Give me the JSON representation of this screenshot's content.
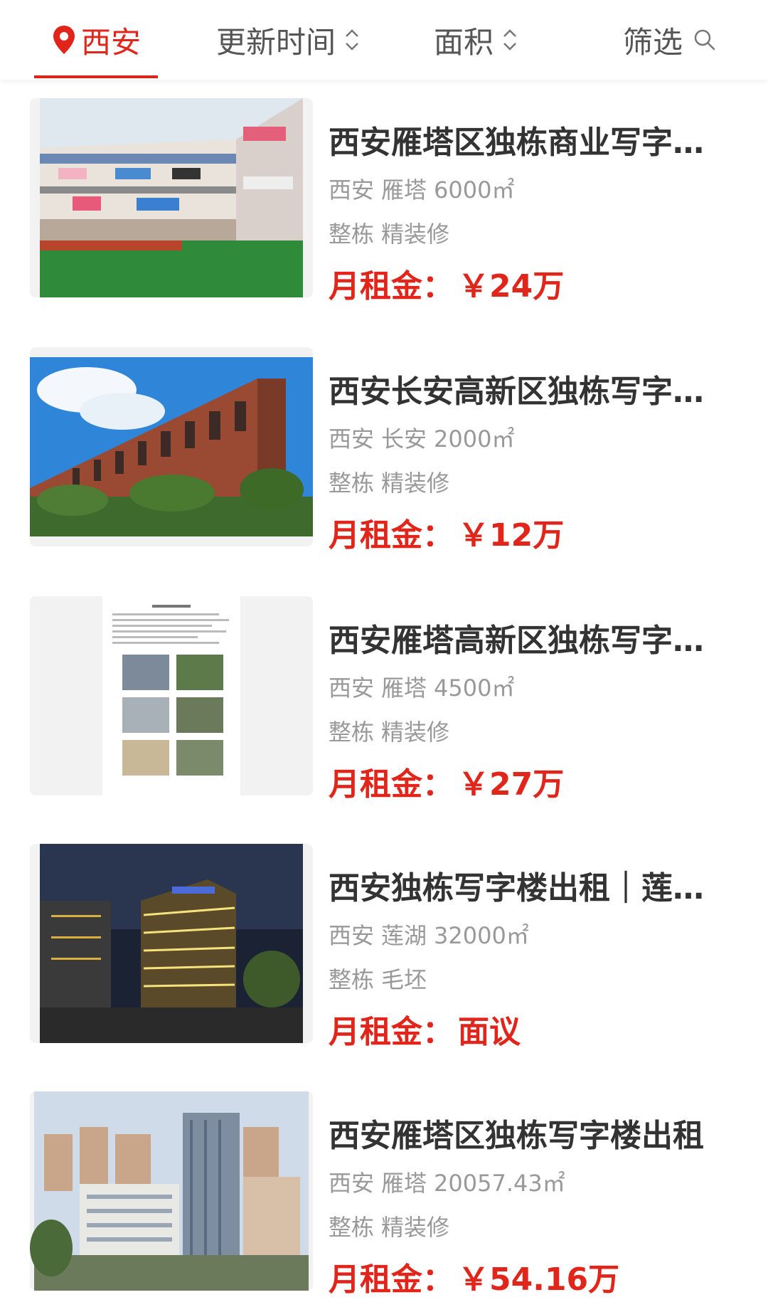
{
  "filter_bar": {
    "city": "西安",
    "sort_time": "更新时间",
    "sort_area": "面积",
    "filter": "筛选"
  },
  "listings": [
    {
      "title": "西安雁塔区独栋商业写字楼出租",
      "city": "西安",
      "district": "雁塔",
      "area": "6000㎡",
      "type": "整栋",
      "decor": "精装修",
      "rent_label": "月租金：",
      "rent": "￥24万"
    },
    {
      "title": "西安长安高新区独栋写字楼出租",
      "city": "西安",
      "district": "长安",
      "area": "2000㎡",
      "type": "整栋",
      "decor": "精装修",
      "rent_label": "月租金：",
      "rent": "￥12万"
    },
    {
      "title": "西安雁塔高新区独栋写字楼出租",
      "city": "西安",
      "district": "雁塔",
      "area": "4500㎡",
      "type": "整栋",
      "decor": "精装修",
      "rent_label": "月租金：",
      "rent": "￥27万"
    },
    {
      "title": "西安独栋写字楼出租｜莲湖区",
      "city": "西安",
      "district": "莲湖",
      "area": "32000㎡",
      "type": "整栋",
      "decor": "毛坯",
      "rent_label": "月租金：",
      "rent": "面议"
    },
    {
      "title": "西安雁塔区独栋写字楼出租",
      "city": "西安",
      "district": "雁塔",
      "area": "20057.43㎡",
      "type": "整栋",
      "decor": "精装修",
      "rent_label": "月租金：",
      "rent": "￥54.16万"
    }
  ]
}
